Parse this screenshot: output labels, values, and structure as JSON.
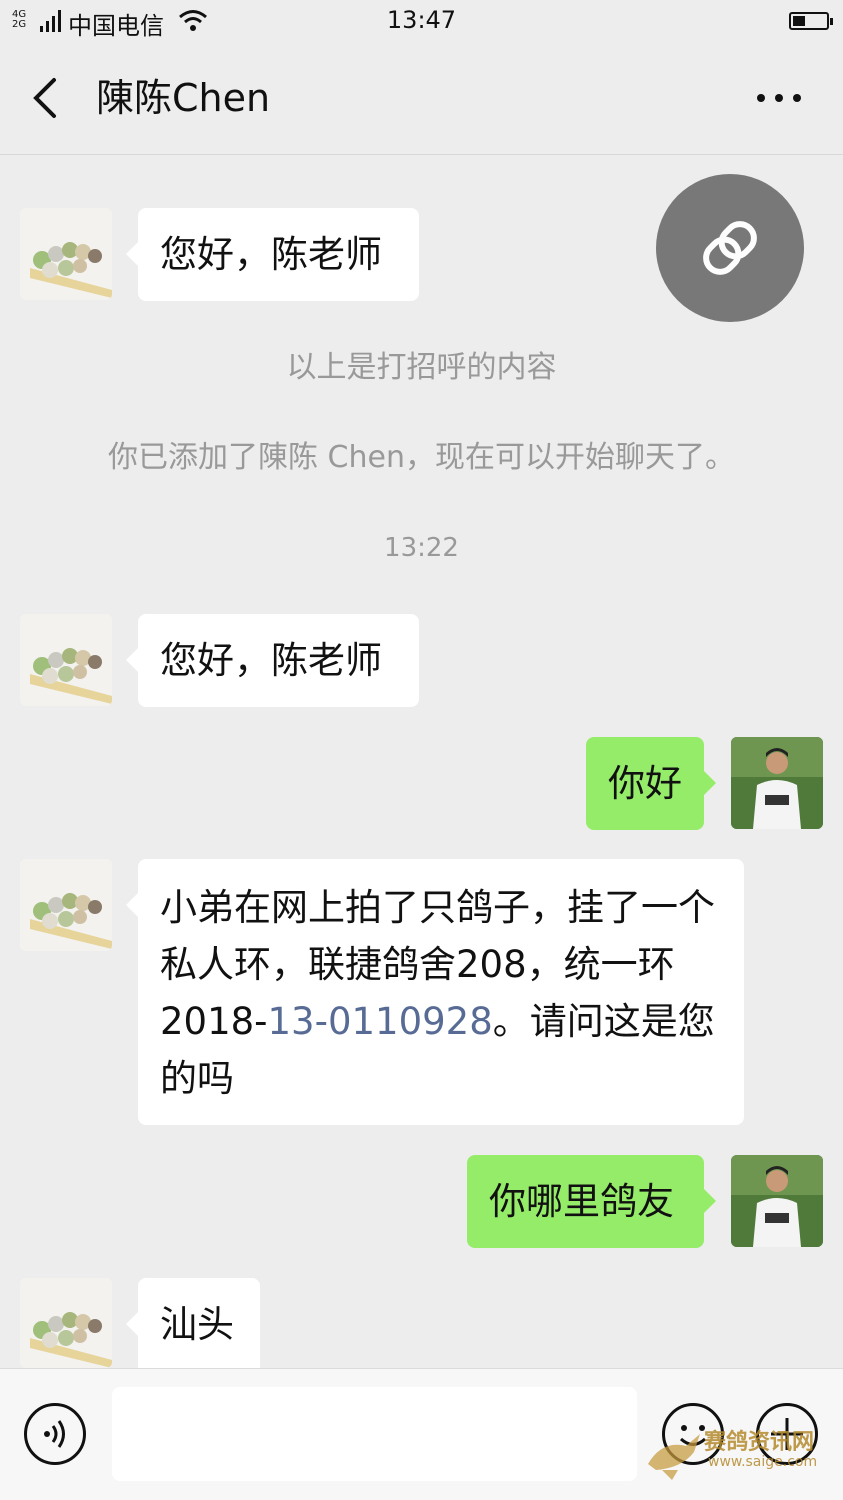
{
  "status_bar": {
    "network": "4G\n2G",
    "carrier": "中国电信",
    "time": "13:47"
  },
  "header": {
    "title": "陳陈Chen"
  },
  "messages": [
    {
      "side": "left",
      "text": "您好，陈老师"
    },
    {
      "side": "left",
      "text": "您好，陈老师"
    },
    {
      "side": "right",
      "text": "你好"
    },
    {
      "side": "left",
      "text_before": "小弟在网上拍了只鸽子，挂了一个私人环，联捷鸽舍208，统一环 2018-",
      "link_number": "13-0110928",
      "text_after": "。请问这是您的吗"
    },
    {
      "side": "right",
      "text": "你哪里鸽友"
    },
    {
      "side": "left",
      "text": "汕头"
    }
  ],
  "system": {
    "greeting_note": "以上是打招呼的内容",
    "added_note": "你已添加了陳陈 Chen，现在可以开始聊天了。",
    "timestamp": "13:22"
  },
  "input_bar": {
    "value": ""
  },
  "watermark": {
    "name": "赛鸽资讯网",
    "url": "www.saige.com"
  },
  "colors": {
    "background": "#ededed",
    "outgoing_bubble": "#95ec69",
    "incoming_bubble": "#ffffff",
    "link_number": "#576b95",
    "system_text": "#999999"
  },
  "icons": [
    "back-arrow-icon",
    "more-dots-icon",
    "link-icon",
    "voice-icon",
    "emoji-icon",
    "plus-icon",
    "wifi-icon",
    "battery-icon",
    "signal-icon"
  ]
}
